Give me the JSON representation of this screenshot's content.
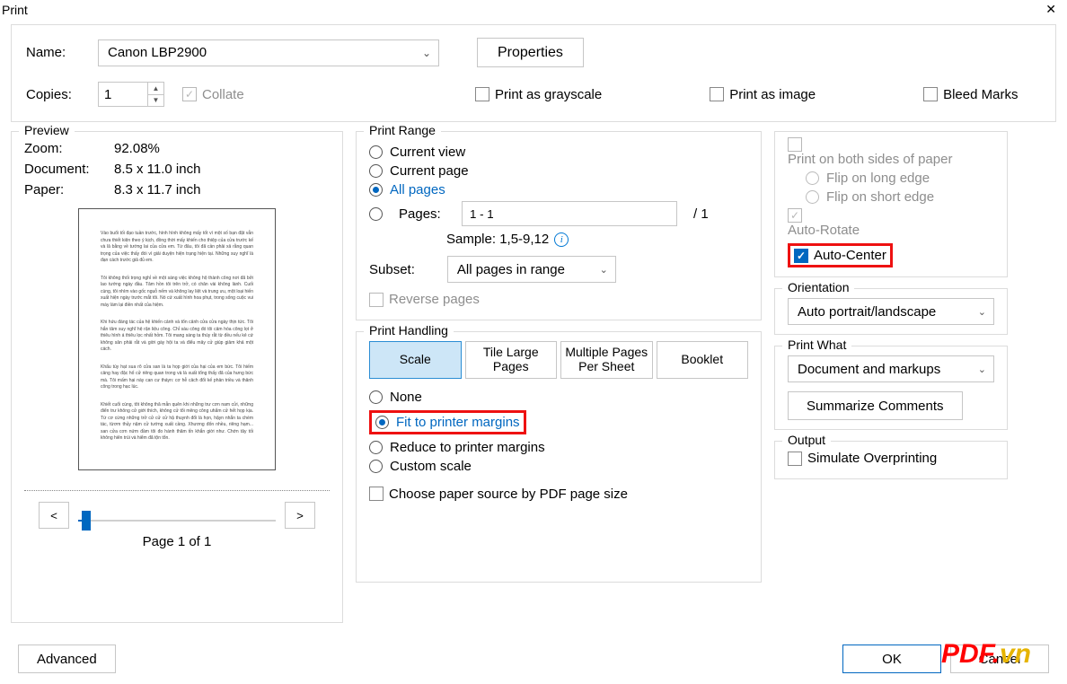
{
  "window": {
    "title": "Print"
  },
  "top": {
    "name_label": "Name:",
    "printer_name": "Canon LBP2900",
    "properties": "Properties",
    "copies_label": "Copies:",
    "copies_value": "1",
    "collate": "Collate",
    "grayscale": "Print as grayscale",
    "as_image": "Print as image",
    "bleed": "Bleed Marks"
  },
  "preview": {
    "legend": "Preview",
    "zoom_label": "Zoom:",
    "zoom_value": "92.08%",
    "doc_label": "Document:",
    "doc_value": "8.5 x 11.0 inch",
    "paper_label": "Paper:",
    "paper_value": "8.3 x 11.7 inch",
    "page_of": "Page 1 of 1",
    "prev": "<",
    "next": ">"
  },
  "range": {
    "legend": "Print Range",
    "current_view": "Current view",
    "current_page": "Current page",
    "all_pages": "All pages",
    "pages": "Pages:",
    "pages_value": "1 - 1",
    "pages_total": "/ 1",
    "sample": "Sample: 1,5-9,12",
    "subset": "Subset:",
    "subset_value": "All pages in range",
    "reverse": "Reverse pages"
  },
  "handling": {
    "legend": "Print Handling",
    "tabs": {
      "scale": "Scale",
      "tile": "Tile Large Pages",
      "multi": "Multiple Pages Per Sheet",
      "booklet": "Booklet"
    },
    "none": "None",
    "fit": "Fit to printer margins",
    "reduce": "Reduce to printer margins",
    "custom": "Custom scale",
    "choose_source": "Choose paper source by PDF page size"
  },
  "right": {
    "both_sides": "Print on both sides of paper",
    "flip_long": "Flip on long edge",
    "flip_short": "Flip on short edge",
    "auto_rotate": "Auto-Rotate",
    "auto_center": "Auto-Center"
  },
  "orientation": {
    "legend": "Orientation",
    "value": "Auto portrait/landscape"
  },
  "print_what": {
    "legend": "Print What",
    "value": "Document and markups",
    "summarize": "Summarize Comments"
  },
  "output": {
    "legend": "Output",
    "simulate": "Simulate Overprinting"
  },
  "footer": {
    "advanced": "Advanced",
    "ok": "OK",
    "cancel": "Cancel"
  },
  "watermark": {
    "main": "PDF",
    "dot": ".",
    "vn": "vn"
  }
}
